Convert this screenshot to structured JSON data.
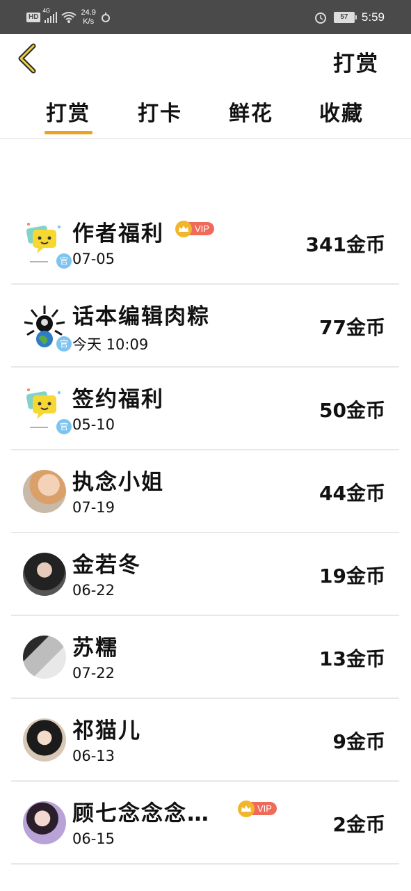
{
  "status_bar": {
    "hd": "HD",
    "network": "4G",
    "speed_value": "24.9",
    "speed_unit": "K/s",
    "battery": "57",
    "time": "5:59"
  },
  "header": {
    "title": "打赏"
  },
  "tabs": [
    {
      "label": "打赏",
      "active": true
    },
    {
      "label": "打卡",
      "active": false
    },
    {
      "label": "鲜花",
      "active": false
    },
    {
      "label": "收藏",
      "active": false
    }
  ],
  "accent_color": "#f0a11d",
  "vip_label": "VIP",
  "official_badge": "官",
  "records": [
    {
      "name": "作者福利",
      "date": "07-05",
      "amount": "341金币",
      "vip": true,
      "official": true,
      "avatar": "chat-bubble"
    },
    {
      "name": "话本编辑肉粽",
      "date": "今天 10:09",
      "amount": "77金币",
      "vip": false,
      "official": true,
      "avatar": "globe"
    },
    {
      "name": "签约福利",
      "date": "05-10",
      "amount": "50金币",
      "vip": false,
      "official": true,
      "avatar": "chat-bubble"
    },
    {
      "name": "执念小姐",
      "date": "07-19",
      "amount": "44金币",
      "vip": false,
      "official": false,
      "avatar": "photo"
    },
    {
      "name": "金若冬",
      "date": "06-22",
      "amount": "19金币",
      "vip": false,
      "official": false,
      "avatar": "photo"
    },
    {
      "name": "苏糯",
      "date": "07-22",
      "amount": "13金币",
      "vip": false,
      "official": false,
      "avatar": "photo"
    },
    {
      "name": "祁猫儿",
      "date": "06-13",
      "amount": "9金币",
      "vip": false,
      "official": false,
      "avatar": "photo"
    },
    {
      "name": "顾七念念念…",
      "date": "06-15",
      "amount": "2金币",
      "vip": true,
      "official": false,
      "avatar": "photo"
    }
  ]
}
